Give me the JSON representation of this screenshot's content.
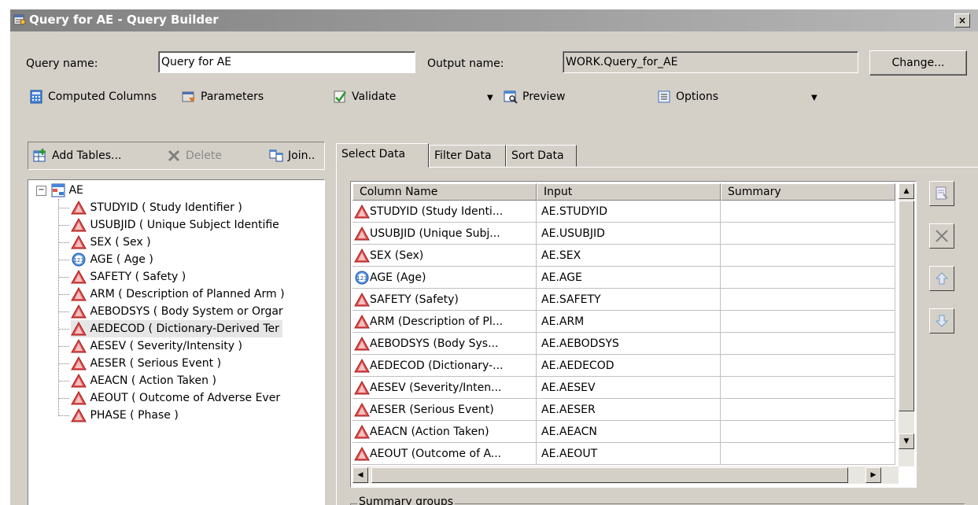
{
  "window": {
    "title": "Query for AE - Query Builder",
    "close_label": "×"
  },
  "form": {
    "query_name_label": "Query name:",
    "query_name_value": "Query for AE",
    "output_name_label": "Output name:",
    "output_name_value": "WORK.Query_for_AE",
    "change_label": "Change..."
  },
  "toolbar": {
    "computed_columns": "Computed Columns",
    "parameters": "Parameters",
    "validate": "Validate",
    "preview": "Preview",
    "options": "Options"
  },
  "left_toolbar": {
    "add_tables": "Add Tables...",
    "delete": "Delete",
    "join": "Join.."
  },
  "tree": {
    "root": "AE",
    "items": [
      {
        "label": "STUDYID ( Study Identifier )",
        "icon": "character-column-icon"
      },
      {
        "label": "USUBJID ( Unique Subject Identifie",
        "icon": "character-column-icon"
      },
      {
        "label": "SEX ( Sex )",
        "icon": "character-column-icon"
      },
      {
        "label": "AGE ( Age )",
        "icon": "numeric-column-icon"
      },
      {
        "label": "SAFETY ( Safety )",
        "icon": "character-column-icon"
      },
      {
        "label": "ARM ( Description of Planned Arm )",
        "icon": "character-column-icon"
      },
      {
        "label": "AEBODSYS ( Body System or Orgar",
        "icon": "character-column-icon"
      },
      {
        "label": "AEDECOD ( Dictionary-Derived Ter",
        "icon": "character-column-icon",
        "selected": true
      },
      {
        "label": "AESEV ( Severity/Intensity )",
        "icon": "character-column-icon"
      },
      {
        "label": "AESER ( Serious Event )",
        "icon": "character-column-icon"
      },
      {
        "label": "AEACN ( Action Taken )",
        "icon": "character-column-icon"
      },
      {
        "label": "AEOUT ( Outcome of Adverse Ever",
        "icon": "character-column-icon"
      },
      {
        "label": "PHASE ( Phase )",
        "icon": "character-column-icon"
      }
    ]
  },
  "tabs": [
    {
      "label": "Select Data",
      "active": true
    },
    {
      "label": "Filter Data",
      "active": false
    },
    {
      "label": "Sort Data",
      "active": false
    }
  ],
  "grid": {
    "columns": [
      "Column Name",
      "Input",
      "Summary"
    ],
    "rows": [
      {
        "name": "STUDYID (Study Identi...",
        "input": "AE.STUDYID",
        "summary": "",
        "icon": "character-column-icon"
      },
      {
        "name": "USUBJID (Unique Subj...",
        "input": "AE.USUBJID",
        "summary": "",
        "icon": "character-column-icon"
      },
      {
        "name": "SEX (Sex)",
        "input": "AE.SEX",
        "summary": "",
        "icon": "character-column-icon"
      },
      {
        "name": "AGE (Age)",
        "input": "AE.AGE",
        "summary": "",
        "icon": "numeric-column-icon"
      },
      {
        "name": "SAFETY (Safety)",
        "input": "AE.SAFETY",
        "summary": "",
        "icon": "character-column-icon"
      },
      {
        "name": "ARM (Description of Pl...",
        "input": "AE.ARM",
        "summary": "",
        "icon": "character-column-icon"
      },
      {
        "name": "AEBODSYS (Body Sys...",
        "input": "AE.AEBODSYS",
        "summary": "",
        "icon": "character-column-icon"
      },
      {
        "name": "AEDECOD (Dictionary-...",
        "input": "AE.AEDECOD",
        "summary": "",
        "icon": "character-column-icon"
      },
      {
        "name": "AESEV (Severity/Inten...",
        "input": "AE.AESEV",
        "summary": "",
        "icon": "character-column-icon"
      },
      {
        "name": "AESER (Serious Event)",
        "input": "AE.AESER",
        "summary": "",
        "icon": "character-column-icon"
      },
      {
        "name": "AEACN (Action Taken)",
        "input": "AE.AEACN",
        "summary": "",
        "icon": "character-column-icon"
      },
      {
        "name": "AEOUT (Outcome of A...",
        "input": "AE.AEOUT",
        "summary": "",
        "icon": "character-column-icon"
      }
    ]
  },
  "summary_groups_label": "Summary groups",
  "colors": {
    "window_face": "#d4d0c8",
    "title_gradient_start": "#808080",
    "char_icon_red": "#cc2222",
    "numeric_icon_blue": "#3a7fd5"
  }
}
